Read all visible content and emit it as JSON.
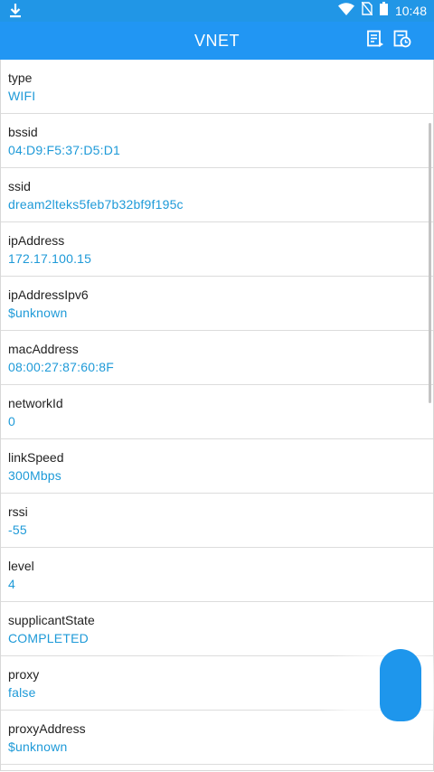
{
  "status_bar": {
    "time": "10:48",
    "icons": [
      "download-icon",
      "wifi-icon",
      "no-sim-icon",
      "battery-icon"
    ]
  },
  "app_bar": {
    "title": "VNET",
    "actions": [
      "notes-icon",
      "history-icon"
    ]
  },
  "items": [
    {
      "key": "type",
      "value": "WIFI"
    },
    {
      "key": "bssid",
      "value": "04:D9:F5:37:D5:D1"
    },
    {
      "key": "ssid",
      "value": "dream2lteks5feb7b32bf9f195c"
    },
    {
      "key": "ipAddress",
      "value": "172.17.100.15"
    },
    {
      "key": "ipAddressIpv6",
      "value": "$unknown"
    },
    {
      "key": "macAddress",
      "value": "08:00:27:87:60:8F"
    },
    {
      "key": "networkId",
      "value": "0"
    },
    {
      "key": "linkSpeed",
      "value": "300Mbps"
    },
    {
      "key": "rssi",
      "value": "-55"
    },
    {
      "key": "level",
      "value": "4"
    },
    {
      "key": "supplicantState",
      "value": "COMPLETED"
    },
    {
      "key": "proxy",
      "value": "false"
    },
    {
      "key": "proxyAddress",
      "value": "$unknown"
    }
  ],
  "colors": {
    "app_bar": "#2196f3",
    "status_bar": "#2196e6",
    "value_text": "#1e9ad8",
    "fab": "#1e96ec"
  }
}
